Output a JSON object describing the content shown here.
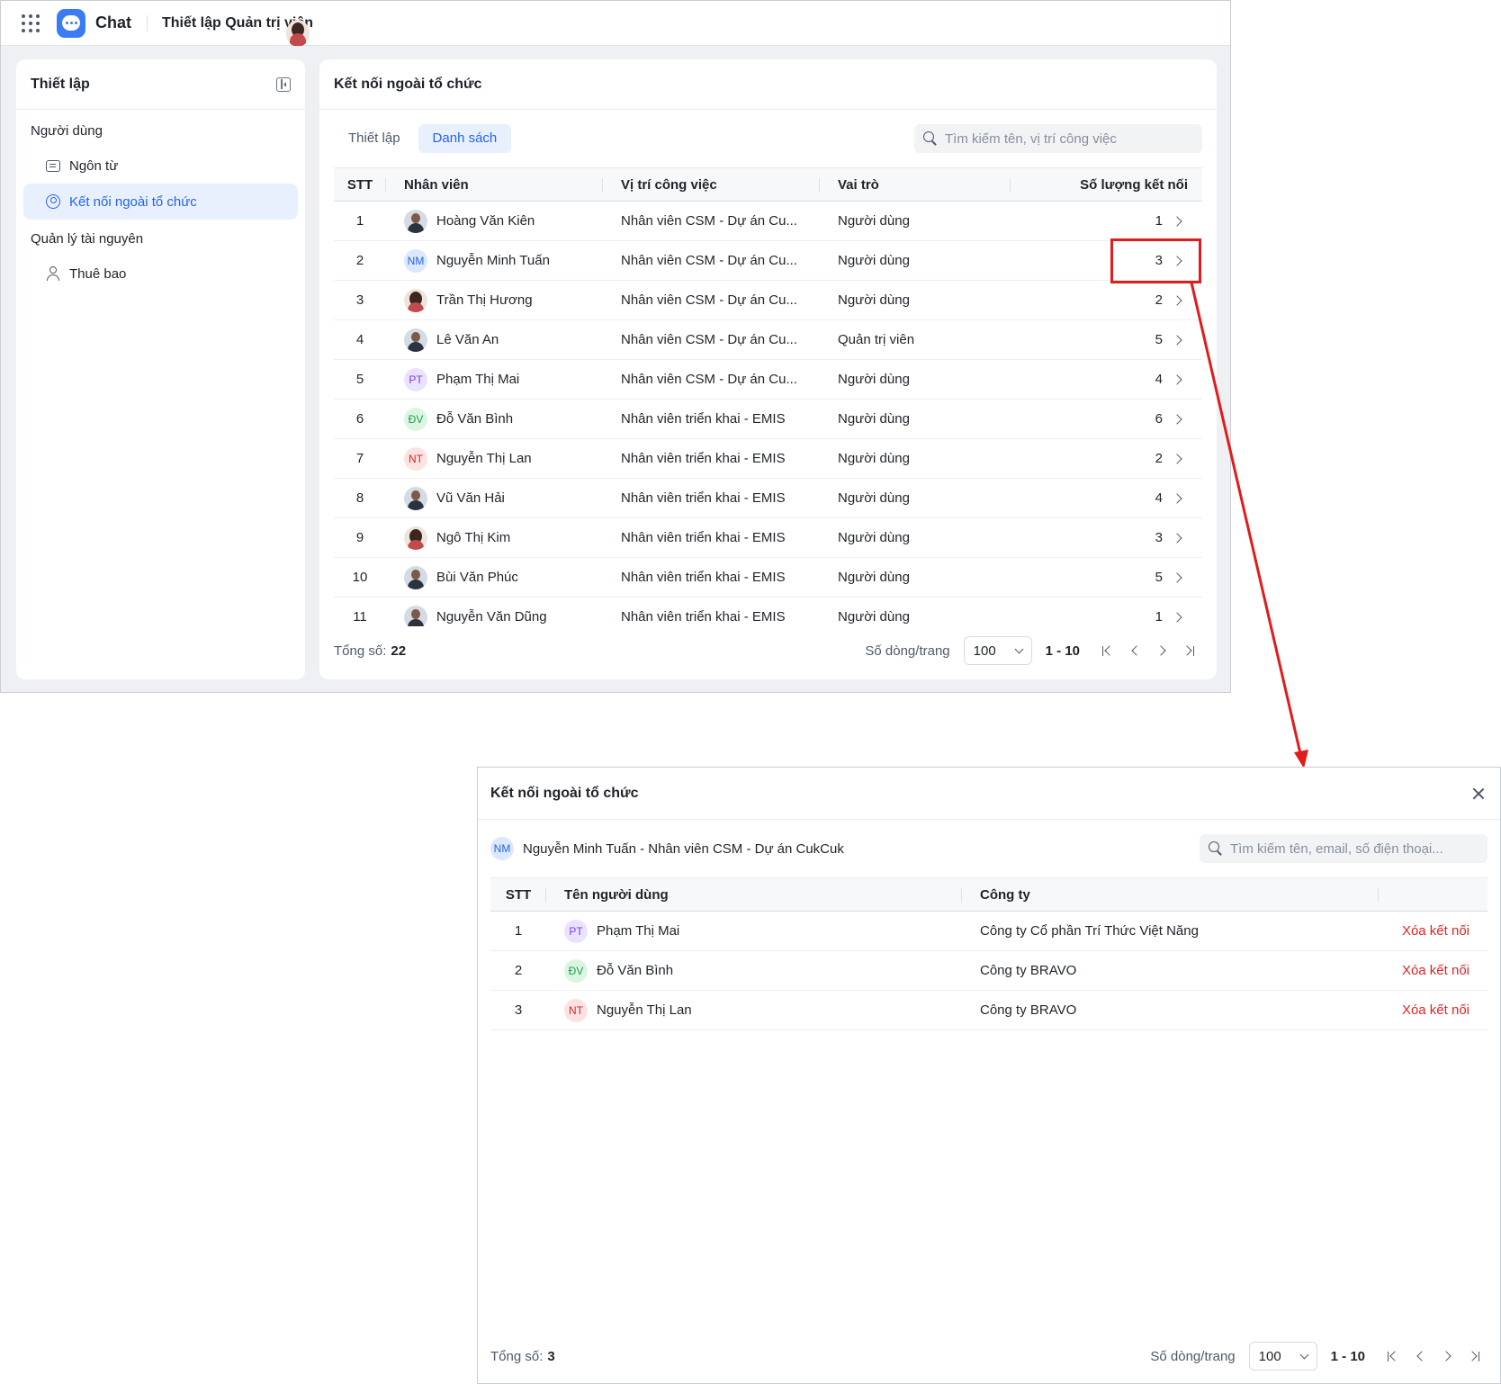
{
  "topbar": {
    "app_name": "Chat",
    "page_title": "Thiết lập Quản trị viên"
  },
  "sidebar": {
    "title": "Thiết lập",
    "groups": [
      {
        "label": "Người dùng",
        "items": [
          {
            "label": "Ngôn từ",
            "icon": "message-icon"
          },
          {
            "label": "Kết nối ngoài tổ chức",
            "icon": "user-circle-icon",
            "active": true
          }
        ]
      },
      {
        "label": "Quản lý tài nguyên",
        "items": [
          {
            "label": "Thuê bao",
            "icon": "person-icon"
          }
        ]
      }
    ]
  },
  "main": {
    "title": "Kết nối ngoài tổ chức",
    "tabs": [
      {
        "label": "Thiết lập"
      },
      {
        "label": "Danh sách",
        "active": true
      }
    ],
    "search_placeholder": "Tìm kiếm tên, vị trí công việc",
    "columns": {
      "stt": "STT",
      "name": "Nhân viên",
      "position": "Vị trí công việc",
      "role": "Vai trò",
      "count": "Số lượng kết nối"
    },
    "rows": [
      {
        "stt": "1",
        "name": "Hoàng Văn Kiên",
        "avatar": "photo",
        "position": "Nhân viên CSM - Dự án Cu...",
        "role": "Người dùng",
        "count": "1"
      },
      {
        "stt": "2",
        "name": "Nguyễn Minh Tuấn",
        "avatar": "NM",
        "position": "Nhân viên CSM - Dự án Cu...",
        "role": "Người dùng",
        "count": "3"
      },
      {
        "stt": "3",
        "name": "Trần Thị Hương",
        "avatar": "photo-f",
        "position": "Nhân viên CSM - Dự án Cu...",
        "role": "Người dùng",
        "count": "2"
      },
      {
        "stt": "4",
        "name": "Lê Văn An",
        "avatar": "photo",
        "position": "Nhân viên CSM - Dự án Cu...",
        "role": "Quản trị viên",
        "count": "5"
      },
      {
        "stt": "5",
        "name": "Phạm Thị Mai",
        "avatar": "PT",
        "position": "Nhân viên CSM - Dự án Cu...",
        "role": "Người dùng",
        "count": "4"
      },
      {
        "stt": "6",
        "name": "Đỗ Văn Bình",
        "avatar": "ĐV",
        "position": "Nhân viên triển khai - EMIS",
        "role": "Người dùng",
        "count": "6"
      },
      {
        "stt": "7",
        "name": "Nguyễn Thị Lan",
        "avatar": "NT",
        "position": "Nhân viên triển khai - EMIS",
        "role": "Người dùng",
        "count": "2"
      },
      {
        "stt": "8",
        "name": "Vũ Văn Hải",
        "avatar": "photo",
        "position": "Nhân viên triển khai - EMIS",
        "role": "Người dùng",
        "count": "4"
      },
      {
        "stt": "9",
        "name": "Ngô Thị Kim",
        "avatar": "photo-f",
        "position": "Nhân viên triển khai - EMIS",
        "role": "Người dùng",
        "count": "3"
      },
      {
        "stt": "10",
        "name": "Bùi Văn Phúc",
        "avatar": "photo",
        "position": "Nhân viên triển khai - EMIS",
        "role": "Người dùng",
        "count": "5"
      },
      {
        "stt": "11",
        "name": "Nguyễn Văn Dũng",
        "avatar": "photo",
        "position": "Nhân viên triển khai - EMIS",
        "role": "Người dùng",
        "count": "1"
      }
    ],
    "footer": {
      "total_label": "Tổng số:",
      "total": "22",
      "page_size_label": "Số dòng/trang",
      "page_size": "100",
      "range": "1 - 10"
    }
  },
  "modal": {
    "title": "Kết nối ngoài tổ chức",
    "user_initials": "NM",
    "user_info": "Nguyễn Minh Tuấn - Nhân viên CSM - Dự án CukCuk",
    "search_placeholder": "Tìm kiếm tên, email, số điện thoại...",
    "columns": {
      "stt": "STT",
      "name": "Tên người dùng",
      "company": "Công ty"
    },
    "rows": [
      {
        "stt": "1",
        "initials": "PT",
        "name": "Phạm Thị Mai",
        "company": "Công ty Cổ phần Trí Thức Việt Năng",
        "action": "Xóa kết nối"
      },
      {
        "stt": "2",
        "initials": "ĐV",
        "name": "Đỗ Văn Bình",
        "company": "Công ty BRAVO",
        "action": "Xóa kết nối"
      },
      {
        "stt": "3",
        "initials": "NT",
        "name": "Nguyễn Thị Lan",
        "company": "Công ty BRAVO",
        "action": "Xóa kết nối"
      }
    ],
    "footer": {
      "total_label": "Tổng số:",
      "total": "3",
      "page_size_label": "Số dòng/trang",
      "page_size": "100",
      "range": "1 - 10"
    }
  },
  "colors": {
    "accent": "#2563eb",
    "annotation": "#e01c1c",
    "danger": "#e02424"
  }
}
